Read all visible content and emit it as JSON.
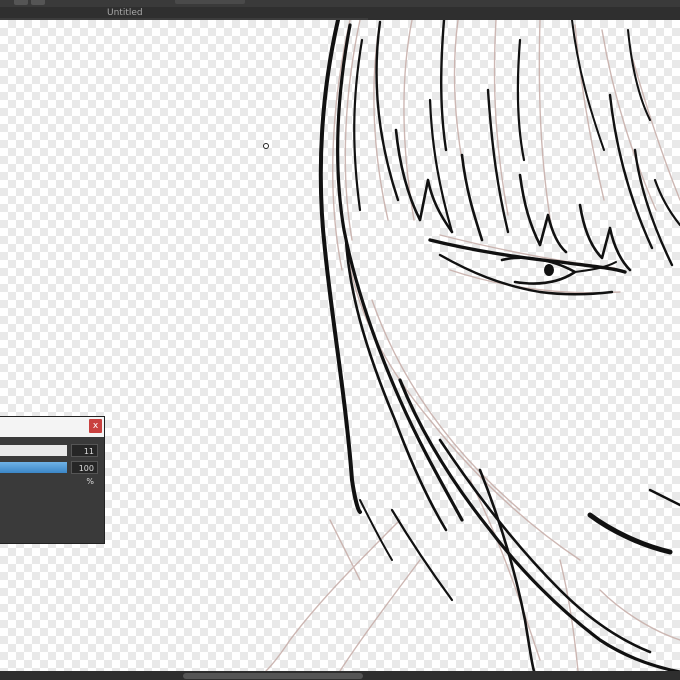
{
  "window": {
    "title": "Untitled"
  },
  "brush_panel": {
    "close_label": "x",
    "size_value": "11",
    "opacity_value": "100 %",
    "opacity_level_percent": 100
  },
  "icons": {
    "close": "close-icon",
    "cursor": "brush-cursor-icon"
  }
}
